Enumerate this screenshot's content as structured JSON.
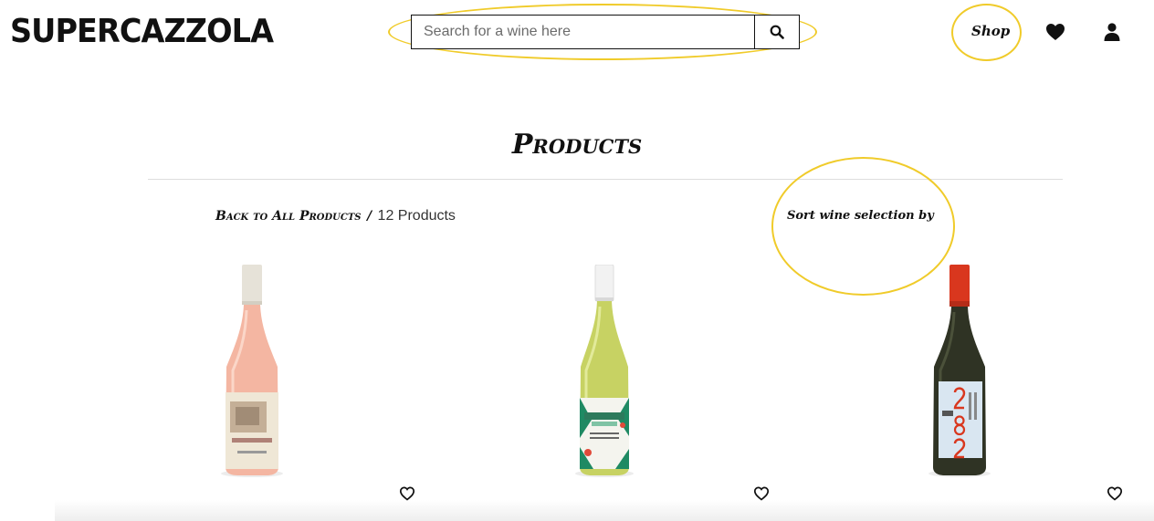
{
  "header": {
    "logo": "SUPERCAZZOLA",
    "search": {
      "placeholder": "Search for a wine here",
      "value": ""
    },
    "nav": {
      "shop_label": "Shop"
    }
  },
  "main": {
    "title": "Products",
    "breadcrumb": {
      "back_label": "Back to All Products",
      "separator": "/",
      "count": "12 Products"
    },
    "sort_label": "Sort wine selection by"
  },
  "products": [
    {
      "name": "rose-bottle",
      "favorite": false
    },
    {
      "name": "alphabetical-white-bottle",
      "favorite": false
    },
    {
      "name": "282-sauvignon-bottle",
      "favorite": false
    }
  ],
  "annotations": {
    "highlight_color": "#f0cb2a"
  }
}
